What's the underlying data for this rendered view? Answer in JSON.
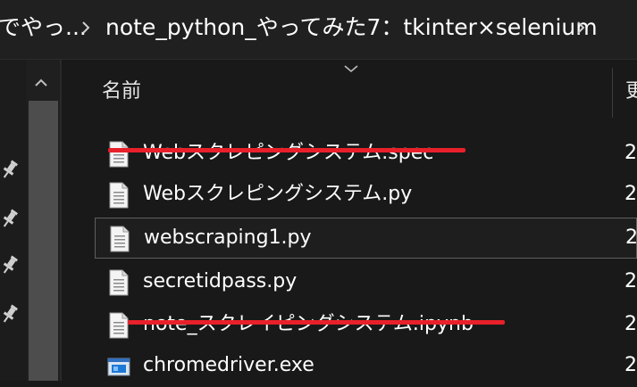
{
  "breadcrumb": {
    "previous": "でやっ...",
    "current": "note_python_やってみた7：tkinter×selenium"
  },
  "file_list": {
    "column_name_header": "名前",
    "column_date_header_partial": "更",
    "rows": [
      {
        "name": "Webスクレピングシステム.spec",
        "date_partial": "2",
        "icon": "text-file-icon",
        "struck_through": true
      },
      {
        "name": "Webスクレピングシステム.py",
        "date_partial": "2",
        "icon": "text-file-icon",
        "struck_through": false
      },
      {
        "name": "webscraping1.py",
        "date_partial": "2",
        "icon": "text-file-icon",
        "struck_through": false,
        "selected": true
      },
      {
        "name": "secretidpass.py",
        "date_partial": "2",
        "icon": "text-file-icon",
        "struck_through": false
      },
      {
        "name": "note_スクレイピングシステム.ipynb",
        "date_partial": "2",
        "icon": "text-file-icon",
        "struck_through": true
      },
      {
        "name": "chromedriver.exe",
        "date_partial": "2",
        "icon": "exe-file-icon",
        "struck_through": false
      }
    ]
  },
  "colors": {
    "background": "#191919",
    "strike_annotation": "#e8202a",
    "selection_border": "#5f5f5f"
  }
}
